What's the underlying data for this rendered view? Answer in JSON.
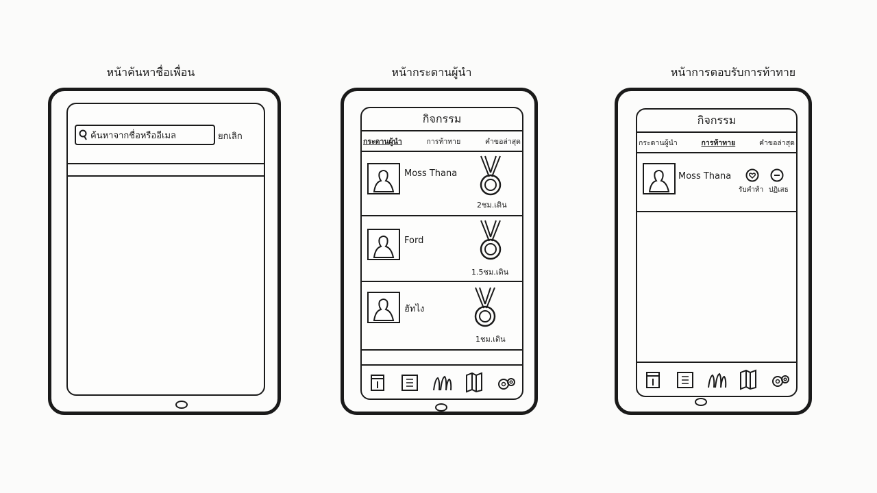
{
  "screens": {
    "search": {
      "caption": "หน้าค้นหาชื่อเพื่อน",
      "search_placeholder": "ค้นหาจากชื่อหรืออีเมล",
      "cancel_label": "ยกเลิก",
      "search_icon": "search-icon"
    },
    "leaderboard": {
      "caption": "หน้ากระดานผู้นำ",
      "title": "กิจกรรม",
      "tabs": [
        "กระดานผู้นำ",
        "การท้าทาย",
        "คำขอล่าสุด"
      ],
      "active_tab": "กระดานผู้นำ",
      "rows": [
        {
          "name": "Moss Thana",
          "stat": "2ชม.เดิน",
          "badge": "medal-icon"
        },
        {
          "name": "Ford",
          "stat": "1.5ชม.เดิน",
          "badge": "medal-icon"
        },
        {
          "name": "ฮัทไง",
          "stat": "1ชม.เดิน",
          "badge": "medal-icon"
        }
      ],
      "nav_icons": [
        "calendar-icon",
        "stats-icon",
        "friends-icon",
        "map-icon",
        "settings-icon"
      ]
    },
    "challenge": {
      "caption": "หน้าการตอบรับการท้าทาย",
      "title": "กิจกรรม",
      "tabs": [
        "กระดานผู้นำ",
        "การท้าทาย",
        "คำขอล่าสุด"
      ],
      "rows": [
        {
          "name": "Moss Thana",
          "accept_label": "รับคำท้า",
          "reject_label": "ปฏิเสธ"
        }
      ],
      "nav_icons": [
        "calendar-icon",
        "stats-icon",
        "friends-icon",
        "map-icon",
        "settings-icon"
      ]
    }
  }
}
